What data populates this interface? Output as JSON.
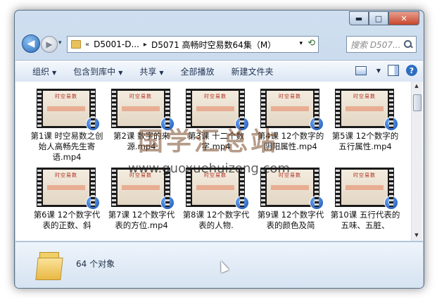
{
  "window": {
    "caption_buttons": [
      {
        "name": "minimize",
        "glyph": "▬"
      },
      {
        "name": "maximize",
        "glyph": "□"
      },
      {
        "name": "close",
        "glyph": "✕"
      }
    ]
  },
  "address_bar": {
    "history_glyph": "▾",
    "overflow": "«",
    "crumbs": [
      "D5001-D...",
      "D5071 高畅时空易数64集（M）"
    ],
    "separator": "▸",
    "refresh_glyph": "⟲"
  },
  "search": {
    "placeholder": "搜索 D507..."
  },
  "toolbar": {
    "organize": "组织",
    "include": "包含到库中",
    "share": "共享",
    "play_all": "全部播放",
    "new_folder": "新建文件夹",
    "help": "?"
  },
  "thumb_title": "时空易数",
  "files": [
    {
      "label": "第1课 时空易数之创始人高畅先生寄语.mp4"
    },
    {
      "label": "第2课 数字的来源.mp4"
    },
    {
      "label": "第3课 十二个数字.mp4"
    },
    {
      "label": "第4课 12个数字的阴阳属性.mp4"
    },
    {
      "label": "第5课 12个数字的五行属性.mp4"
    },
    {
      "label": "第6课 12个数字代表的正数、斜"
    },
    {
      "label": "第7课 12个数字代表的方位.mp4"
    },
    {
      "label": "第8课 12个数字代表的人物."
    },
    {
      "label": "第9课 12个数字代表的颜色及简"
    },
    {
      "label": "第10课 五行代表的五味、五脏、"
    }
  ],
  "status": {
    "count": "64 个对象"
  },
  "watermark": {
    "text": "国学汇总站",
    "url": "www.guoxuehuizong.com"
  },
  "colors": {
    "accent": "#2b6bb8",
    "window_frame": "#b9cde4",
    "close": "#c7462c"
  }
}
